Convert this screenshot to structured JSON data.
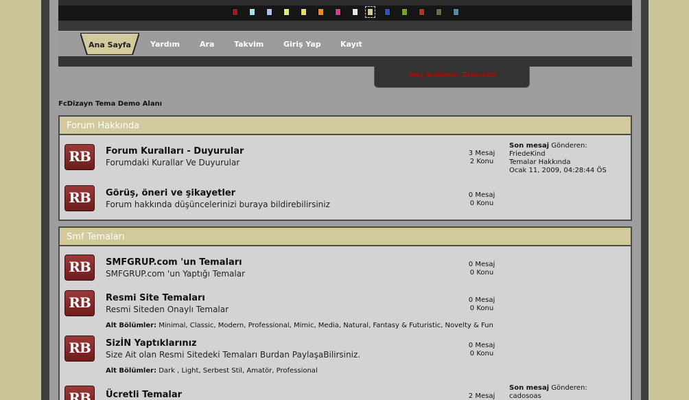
{
  "swatches": [
    "#a8131c",
    "#a9dcef",
    "#a6c4ec",
    "#e3e38c",
    "#e8da5a",
    "#f08a1a",
    "#ec2f8a",
    "#e6e6e6",
    "#d1ca9f",
    "#2b57b4",
    "#76a02a",
    "#b2351f",
    "#6c6b45",
    "#4b8ea6"
  ],
  "menu": {
    "active": "Ana Sayfa",
    "items": [
      "Yardım",
      "Ara",
      "Takvim",
      "Giriş Yap",
      "Kayıt"
    ]
  },
  "welcome": "Hoş Geldiniz, Ziyaretçi",
  "forum_title": "FcDizayn Tema Demo Alanı",
  "categories": [
    {
      "title": "Forum Hakkında",
      "boards": [
        {
          "icon": "RB",
          "name": "Forum Kuralları - Duyurular",
          "desc": "Forumdaki Kurallar Ve Duyurular",
          "posts": "3 Mesaj",
          "topics": "2 Konu",
          "last_label": "Son mesaj",
          "last_by": "Gönderen:",
          "last_user": "FriedeKind",
          "last_topic": "Temalar Hakkında",
          "last_date": "Ocak 11, 2009, 04:28:44 ÖS"
        },
        {
          "icon": "RB",
          "name": "Görüş, öneri ve şikayetler",
          "desc": "Forum hakkında düşüncelerinizi buraya bildirebilirsiniz",
          "posts": "0 Mesaj",
          "topics": "0 Konu"
        }
      ]
    },
    {
      "title": "Smf Temaları",
      "boards": [
        {
          "icon": "RB",
          "name": "SMFGRUP.com 'un Temaları",
          "desc": "SMFGRUP.com 'un Yaptığı Temalar",
          "posts": "0 Mesaj",
          "topics": "0 Konu"
        },
        {
          "icon": "RB",
          "name": "Resmi Site Temaları",
          "desc": "Resmi Siteden Onaylı Temalar",
          "posts": "0 Mesaj",
          "topics": "0 Konu",
          "children_label": "Alt Bölümler:",
          "children": "Minimal, Classic, Modern, Professional, Mimic, Media, Natural, Fantasy & Futuristic, Novelty & Fun"
        },
        {
          "icon": "RB",
          "name": "SizİN Yaptıklarınız",
          "desc": "Size Ait olan Resmi Sitedeki Temaları Burdan PaylaşaBilirsiniz.",
          "posts": "0 Mesaj",
          "topics": "0 Konu",
          "children_label": "Alt Bölümler:",
          "children": "Dark , Light, Serbest Stil, Amatör, Professional"
        },
        {
          "icon": "RB",
          "name": "Ücretli Temalar",
          "desc": "",
          "posts": "2 Mesaj",
          "topics": "",
          "last_label": "Son mesaj",
          "last_by": "Gönderen:",
          "last_user": "cadosoas"
        }
      ]
    }
  ]
}
